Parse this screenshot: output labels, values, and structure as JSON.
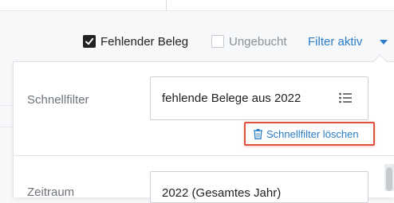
{
  "filters": {
    "missing_receipt": {
      "label": "Fehlender Beleg",
      "checked": true
    },
    "unbooked": {
      "label": "Ungebucht",
      "checked": false
    },
    "filter_toggle_label": "Filter aktiv"
  },
  "panel": {
    "quickfilter": {
      "label": "Schnellfilter",
      "value": "fehlende Belege aus 2022",
      "clear_label": "Schnellfilter löschen"
    },
    "period": {
      "label": "Zeitraum",
      "value": "2022 (Gesamtes Jahr)"
    }
  },
  "colors": {
    "accent": "#2a7cc7",
    "highlight": "#e0503a"
  },
  "icons": [
    "check-icon",
    "chevron-down-icon",
    "list-icon",
    "trash-icon"
  ]
}
